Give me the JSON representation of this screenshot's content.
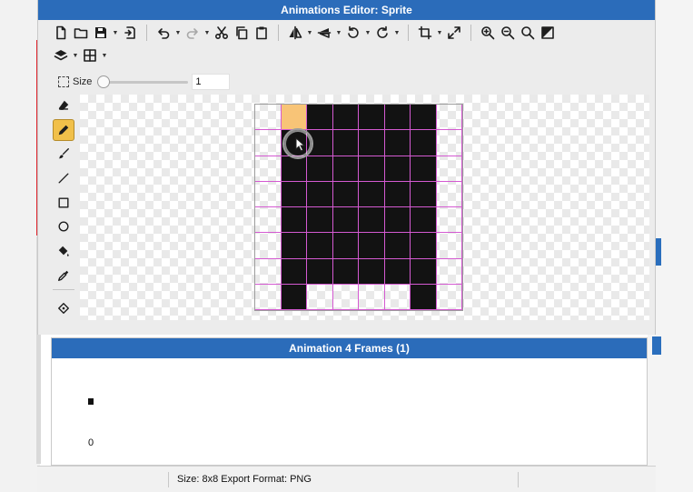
{
  "window": {
    "title": "Animations Editor: Sprite"
  },
  "toolbar": {
    "row1": [
      {
        "name": "new-file-icon",
        "drop": false
      },
      {
        "name": "open-folder-icon",
        "drop": false
      },
      {
        "name": "save-icon",
        "drop": true
      },
      {
        "name": "export-icon",
        "drop": false,
        "sep_after": true
      },
      {
        "name": "undo-icon",
        "drop": true
      },
      {
        "name": "redo-icon",
        "drop": true
      },
      {
        "name": "cut-icon",
        "drop": false
      },
      {
        "name": "copy-icon",
        "drop": false
      },
      {
        "name": "paste-icon",
        "drop": false,
        "sep_after": true
      },
      {
        "name": "flip-horizontal-icon",
        "drop": true
      },
      {
        "name": "flip-vertical-icon",
        "drop": true
      },
      {
        "name": "rotate-left-icon",
        "drop": true
      },
      {
        "name": "rotate-right-icon",
        "drop": true,
        "sep_after": true
      },
      {
        "name": "crop-icon",
        "drop": true
      },
      {
        "name": "resize-icon",
        "drop": false,
        "sep_after": true
      },
      {
        "name": "zoom-in-icon",
        "drop": false
      },
      {
        "name": "zoom-out-icon",
        "drop": false
      },
      {
        "name": "zoom-fit-icon",
        "drop": false
      },
      {
        "name": "invert-icon",
        "drop": false
      }
    ],
    "row2": [
      {
        "name": "layers-icon",
        "drop": true
      },
      {
        "name": "grid-icon",
        "drop": true
      }
    ]
  },
  "brush": {
    "label": "Size",
    "value": "1",
    "level_fraction": 0
  },
  "tools": [
    {
      "name": "eraser-icon",
      "active": false
    },
    {
      "name": "pencil-icon",
      "active": true
    },
    {
      "name": "brush-icon",
      "active": false
    },
    {
      "name": "line-icon",
      "active": false
    },
    {
      "name": "rectangle-icon",
      "active": false
    },
    {
      "name": "ellipse-icon",
      "active": false
    },
    {
      "name": "paint-bucket-icon",
      "active": false
    },
    {
      "name": "eyedropper-icon",
      "active": false
    },
    {
      "name": "divider",
      "active": false
    },
    {
      "name": "pivot-icon",
      "active": false
    }
  ],
  "sprite": {
    "columns": 8,
    "rows": 8,
    "palette": {
      "0": "transparent",
      "1": "#121212",
      "2": "#f8c477"
    },
    "pixels": [
      [
        0,
        2,
        1,
        1,
        1,
        1,
        1,
        0
      ],
      [
        0,
        1,
        1,
        1,
        1,
        1,
        1,
        0
      ],
      [
        0,
        1,
        1,
        1,
        1,
        1,
        1,
        0
      ],
      [
        0,
        1,
        1,
        1,
        1,
        1,
        1,
        0
      ],
      [
        0,
        1,
        1,
        1,
        1,
        1,
        1,
        0
      ],
      [
        0,
        1,
        1,
        1,
        1,
        1,
        1,
        0
      ],
      [
        0,
        1,
        1,
        1,
        1,
        1,
        1,
        0
      ],
      [
        0,
        1,
        0,
        0,
        0,
        0,
        1,
        0
      ]
    ]
  },
  "animation": {
    "title": "Animation 4 Frames (1)",
    "frames": [
      {
        "index": "0"
      }
    ]
  },
  "status": {
    "text": "Size: 8x8   Export Format: PNG"
  },
  "colors": {
    "titlebar": "#2b6cba",
    "grid_line": "#d45ad1",
    "active_tool": "#f1c04a",
    "highlight_pixel": "#f8c477"
  }
}
